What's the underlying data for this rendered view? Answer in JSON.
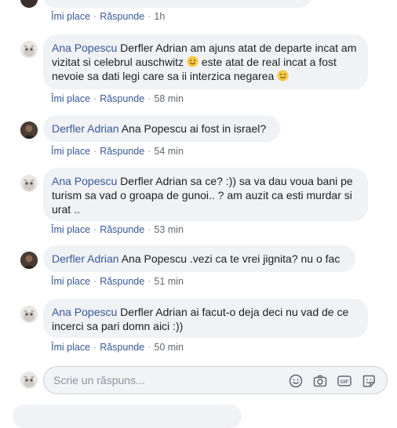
{
  "top_actions": {
    "like": "Îmi place",
    "reply": "Răspunde",
    "time": "1h"
  },
  "comments": [
    {
      "author": "Ana Popescu",
      "text_1": " Derfler Adrian am ajuns atat de departe incat am vizitat si celebrul auschwitz ",
      "text_2": " este atat de real incat a fost nevoie sa dati legi care sa ii interzica negarea ",
      "like": "Îmi place",
      "reply": "Răspunde",
      "time": "58 min"
    },
    {
      "author": "Derfler Adrian",
      "text": " Ana Popescu ai fost in israel?",
      "like": "Îmi place",
      "reply": "Răspunde",
      "time": "54 min"
    },
    {
      "author": "Ana Popescu",
      "text": " Derfler Adrian sa ce? :)) sa va dau voua bani pe turism sa vad o groapa de gunoi.. ? am auzit ca esti murdar si urat ..",
      "like": "Îmi place",
      "reply": "Răspunde",
      "time": "53 min"
    },
    {
      "author": "Derfler Adrian",
      "text": " Ana Popescu .vezi ca te vrei jignita? nu o fac",
      "like": "Îmi place",
      "reply": "Răspunde",
      "time": "51 min"
    },
    {
      "author": "Ana Popescu",
      "text": " Derfler Adrian ai facut-o deja deci nu vad de ce incerci sa pari domn aici :))",
      "like": "Îmi place",
      "reply": "Răspunde",
      "time": "50 min"
    }
  ],
  "reply_box": {
    "placeholder": "Scrie un răspuns..."
  },
  "colors": {
    "link": "#385898",
    "bubble": "#f0f2f5",
    "meta": "#616770"
  },
  "icons": [
    "emoji-icon",
    "camera-icon",
    "gif-icon",
    "sticker-icon"
  ]
}
